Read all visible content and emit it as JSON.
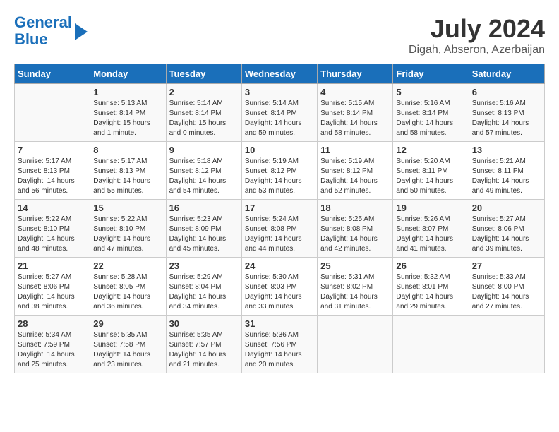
{
  "header": {
    "logo_line1": "General",
    "logo_line2": "Blue",
    "main_title": "July 2024",
    "subtitle": "Digah, Abseron, Azerbaijan"
  },
  "days_of_week": [
    "Sunday",
    "Monday",
    "Tuesday",
    "Wednesday",
    "Thursday",
    "Friday",
    "Saturday"
  ],
  "weeks": [
    [
      {
        "day": "",
        "info": ""
      },
      {
        "day": "1",
        "info": "Sunrise: 5:13 AM\nSunset: 8:14 PM\nDaylight: 15 hours\nand 1 minute."
      },
      {
        "day": "2",
        "info": "Sunrise: 5:14 AM\nSunset: 8:14 PM\nDaylight: 15 hours\nand 0 minutes."
      },
      {
        "day": "3",
        "info": "Sunrise: 5:14 AM\nSunset: 8:14 PM\nDaylight: 14 hours\nand 59 minutes."
      },
      {
        "day": "4",
        "info": "Sunrise: 5:15 AM\nSunset: 8:14 PM\nDaylight: 14 hours\nand 58 minutes."
      },
      {
        "day": "5",
        "info": "Sunrise: 5:16 AM\nSunset: 8:14 PM\nDaylight: 14 hours\nand 58 minutes."
      },
      {
        "day": "6",
        "info": "Sunrise: 5:16 AM\nSunset: 8:13 PM\nDaylight: 14 hours\nand 57 minutes."
      }
    ],
    [
      {
        "day": "7",
        "info": "Sunrise: 5:17 AM\nSunset: 8:13 PM\nDaylight: 14 hours\nand 56 minutes."
      },
      {
        "day": "8",
        "info": "Sunrise: 5:17 AM\nSunset: 8:13 PM\nDaylight: 14 hours\nand 55 minutes."
      },
      {
        "day": "9",
        "info": "Sunrise: 5:18 AM\nSunset: 8:12 PM\nDaylight: 14 hours\nand 54 minutes."
      },
      {
        "day": "10",
        "info": "Sunrise: 5:19 AM\nSunset: 8:12 PM\nDaylight: 14 hours\nand 53 minutes."
      },
      {
        "day": "11",
        "info": "Sunrise: 5:19 AM\nSunset: 8:12 PM\nDaylight: 14 hours\nand 52 minutes."
      },
      {
        "day": "12",
        "info": "Sunrise: 5:20 AM\nSunset: 8:11 PM\nDaylight: 14 hours\nand 50 minutes."
      },
      {
        "day": "13",
        "info": "Sunrise: 5:21 AM\nSunset: 8:11 PM\nDaylight: 14 hours\nand 49 minutes."
      }
    ],
    [
      {
        "day": "14",
        "info": "Sunrise: 5:22 AM\nSunset: 8:10 PM\nDaylight: 14 hours\nand 48 minutes."
      },
      {
        "day": "15",
        "info": "Sunrise: 5:22 AM\nSunset: 8:10 PM\nDaylight: 14 hours\nand 47 minutes."
      },
      {
        "day": "16",
        "info": "Sunrise: 5:23 AM\nSunset: 8:09 PM\nDaylight: 14 hours\nand 45 minutes."
      },
      {
        "day": "17",
        "info": "Sunrise: 5:24 AM\nSunset: 8:08 PM\nDaylight: 14 hours\nand 44 minutes."
      },
      {
        "day": "18",
        "info": "Sunrise: 5:25 AM\nSunset: 8:08 PM\nDaylight: 14 hours\nand 42 minutes."
      },
      {
        "day": "19",
        "info": "Sunrise: 5:26 AM\nSunset: 8:07 PM\nDaylight: 14 hours\nand 41 minutes."
      },
      {
        "day": "20",
        "info": "Sunrise: 5:27 AM\nSunset: 8:06 PM\nDaylight: 14 hours\nand 39 minutes."
      }
    ],
    [
      {
        "day": "21",
        "info": "Sunrise: 5:27 AM\nSunset: 8:06 PM\nDaylight: 14 hours\nand 38 minutes."
      },
      {
        "day": "22",
        "info": "Sunrise: 5:28 AM\nSunset: 8:05 PM\nDaylight: 14 hours\nand 36 minutes."
      },
      {
        "day": "23",
        "info": "Sunrise: 5:29 AM\nSunset: 8:04 PM\nDaylight: 14 hours\nand 34 minutes."
      },
      {
        "day": "24",
        "info": "Sunrise: 5:30 AM\nSunset: 8:03 PM\nDaylight: 14 hours\nand 33 minutes."
      },
      {
        "day": "25",
        "info": "Sunrise: 5:31 AM\nSunset: 8:02 PM\nDaylight: 14 hours\nand 31 minutes."
      },
      {
        "day": "26",
        "info": "Sunrise: 5:32 AM\nSunset: 8:01 PM\nDaylight: 14 hours\nand 29 minutes."
      },
      {
        "day": "27",
        "info": "Sunrise: 5:33 AM\nSunset: 8:00 PM\nDaylight: 14 hours\nand 27 minutes."
      }
    ],
    [
      {
        "day": "28",
        "info": "Sunrise: 5:34 AM\nSunset: 7:59 PM\nDaylight: 14 hours\nand 25 minutes."
      },
      {
        "day": "29",
        "info": "Sunrise: 5:35 AM\nSunset: 7:58 PM\nDaylight: 14 hours\nand 23 minutes."
      },
      {
        "day": "30",
        "info": "Sunrise: 5:35 AM\nSunset: 7:57 PM\nDaylight: 14 hours\nand 21 minutes."
      },
      {
        "day": "31",
        "info": "Sunrise: 5:36 AM\nSunset: 7:56 PM\nDaylight: 14 hours\nand 20 minutes."
      },
      {
        "day": "",
        "info": ""
      },
      {
        "day": "",
        "info": ""
      },
      {
        "day": "",
        "info": ""
      }
    ]
  ]
}
